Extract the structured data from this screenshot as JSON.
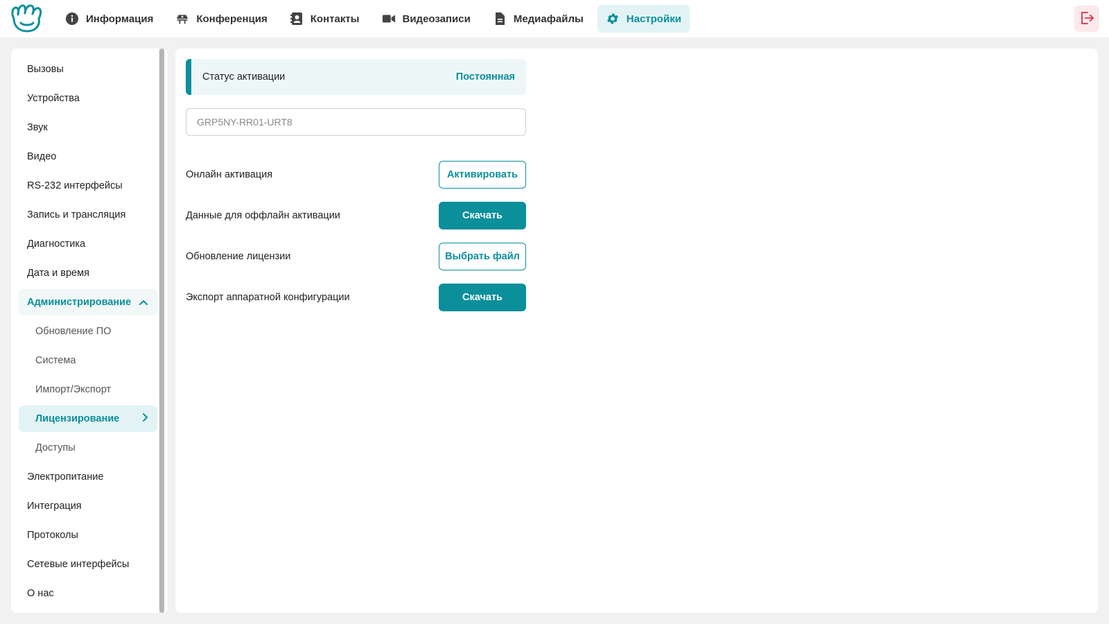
{
  "colors": {
    "accent": "#0a8f9b",
    "accent_light": "#e3f3f5",
    "logout": "#e0405a"
  },
  "nav": {
    "items": [
      {
        "label": "Информация",
        "icon": "info-icon"
      },
      {
        "label": "Конференция",
        "icon": "conference-icon"
      },
      {
        "label": "Контакты",
        "icon": "contacts-icon"
      },
      {
        "label": "Видеозаписи",
        "icon": "video-camera-icon"
      },
      {
        "label": "Медиафайлы",
        "icon": "document-icon"
      },
      {
        "label": "Настройки",
        "icon": "gear-icon",
        "active": true
      }
    ],
    "logout_icon": "logout-icon"
  },
  "sidebar": {
    "items": [
      {
        "label": "Вызовы"
      },
      {
        "label": "Устройства"
      },
      {
        "label": "Звук"
      },
      {
        "label": "Видео"
      },
      {
        "label": "RS-232 интерфейсы"
      },
      {
        "label": "Запись и трансляция"
      },
      {
        "label": "Диагностика"
      },
      {
        "label": "Дата и время"
      },
      {
        "label": "Администрирование",
        "expanded": true
      },
      {
        "label": "Обновление ПО",
        "sub": true
      },
      {
        "label": "Система",
        "sub": true
      },
      {
        "label": "Импорт/Экспорт",
        "sub": true
      },
      {
        "label": "Лицензирование",
        "sub": true,
        "selected": true
      },
      {
        "label": "Доступы",
        "sub": true
      },
      {
        "label": "Электропитание"
      },
      {
        "label": "Интеграция"
      },
      {
        "label": "Протоколы"
      },
      {
        "label": "Сетевые интерфейсы"
      },
      {
        "label": "О нас"
      }
    ]
  },
  "licensing": {
    "status_label": "Статус активации",
    "status_value": "Постоянная",
    "key_value": "GRP5NY-RR01-URT8",
    "rows": [
      {
        "label": "Онлайн активация",
        "button": "Активировать",
        "style": "outline"
      },
      {
        "label": "Данные для оффлайн активации",
        "button": "Скачать",
        "style": "filled"
      },
      {
        "label": "Обновление лицензии",
        "button": "Выбрать файл",
        "style": "outline"
      },
      {
        "label": "Экспорт аппаратной конфигурации",
        "button": "Скачать",
        "style": "filled"
      }
    ]
  }
}
